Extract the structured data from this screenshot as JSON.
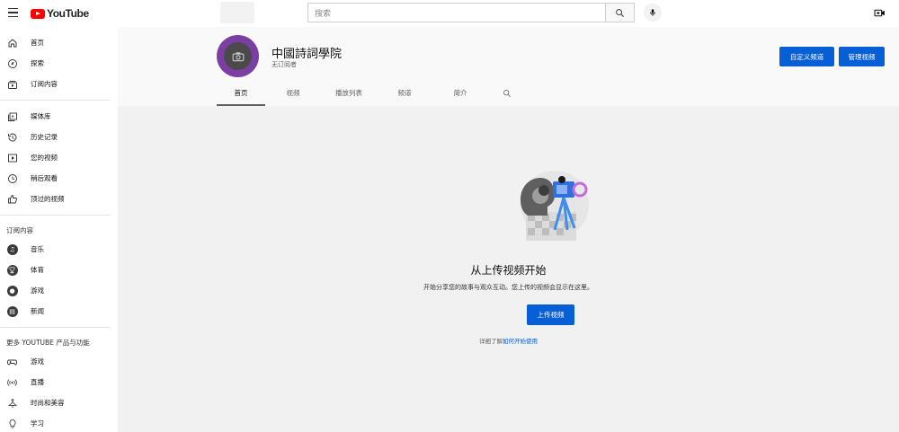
{
  "topbar": {
    "logo_text": "YouTube",
    "search_placeholder": "搜索"
  },
  "sidebar": {
    "primary": [
      {
        "label": "首页",
        "icon": "home-icon"
      },
      {
        "label": "探索",
        "icon": "compass-icon"
      },
      {
        "label": "订阅内容",
        "icon": "subscriptions-icon"
      }
    ],
    "library": [
      {
        "label": "媒体库",
        "icon": "library-icon"
      },
      {
        "label": "历史记录",
        "icon": "history-icon"
      },
      {
        "label": "您的视频",
        "icon": "your-videos-icon"
      },
      {
        "label": "稍后观看",
        "icon": "watch-later-icon"
      },
      {
        "label": "顶过的视频",
        "icon": "thumbs-up-icon"
      }
    ],
    "subscriptions_heading": "订阅内容",
    "subscriptions": [
      {
        "label": "音乐",
        "icon": "music-icon"
      },
      {
        "label": "体育",
        "icon": "trophy-icon"
      },
      {
        "label": "游戏",
        "icon": "gaming-icon"
      },
      {
        "label": "新闻",
        "icon": "news-icon"
      }
    ],
    "more_heading": "更多 YOUTUBE 产品与功能",
    "more": [
      {
        "label": "游戏",
        "icon": "gamepad-icon"
      },
      {
        "label": "直播",
        "icon": "live-icon"
      },
      {
        "label": "时尚和美容",
        "icon": "hanger-icon"
      },
      {
        "label": "学习",
        "icon": "lightbulb-icon"
      }
    ]
  },
  "channel": {
    "name": "中國詩詞學院",
    "subscribers": "无订阅者",
    "customize_label": "自定义频道",
    "manage_label": "管理视频",
    "tabs": [
      "首页",
      "视频",
      "播放列表",
      "频道",
      "简介"
    ]
  },
  "empty_state": {
    "title": "从上传视频开始",
    "subtitle": "开始分享您的故事与观众互动。您上传的视频会显示在这里。",
    "upload_label": "上传视频",
    "learn_prefix": "详细了解",
    "learn_link": "如何开始使用"
  },
  "colors": {
    "accent": "#065fd4",
    "brand_red": "#ff0000",
    "avatar_purple": "#7b3fa3"
  }
}
